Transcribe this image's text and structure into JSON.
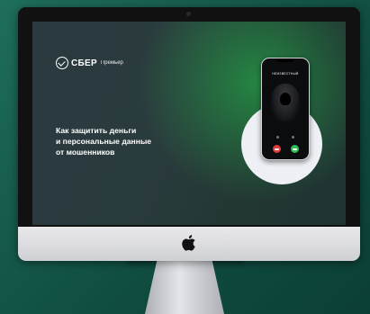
{
  "brand": {
    "name": "СБЕР",
    "sub": "Премьер"
  },
  "headline": [
    "Как защитить деньги",
    "и персональные данные",
    "от мошенников"
  ],
  "phone": {
    "caller_label": "НЕИЗВЕСТНЫЙ"
  },
  "colors": {
    "background": "#165a4c",
    "decline": "#e23b3b",
    "accept": "#2fbf55",
    "screen_glow": "#23a046"
  },
  "icons": {
    "brand": "sber-check-icon",
    "apple": "apple-logo-icon",
    "decline": "decline-call-icon",
    "accept": "accept-call-icon"
  }
}
